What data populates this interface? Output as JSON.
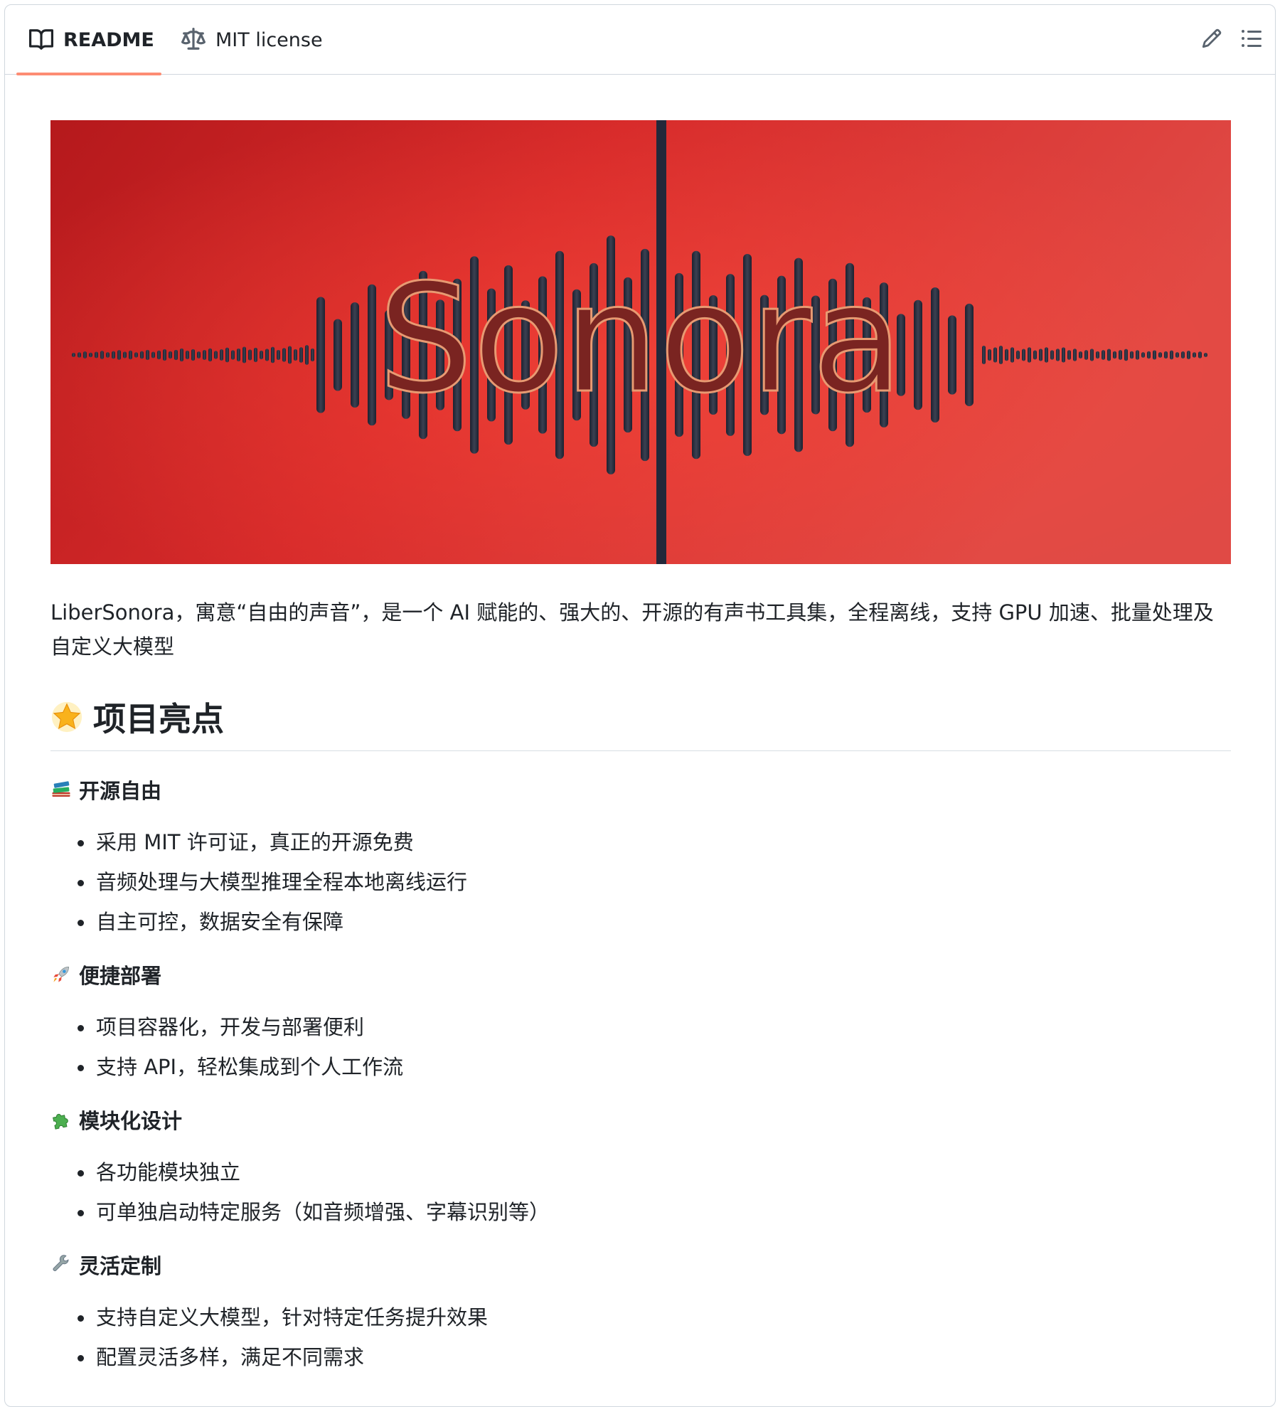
{
  "tabs": {
    "readme_label": "README",
    "license_label": "MIT license"
  },
  "banner": {
    "title": "Sonora",
    "colors": {
      "background": "#d42b2b",
      "bars": "#2a2f3d",
      "letters": "#6e2222"
    }
  },
  "intro": "LiberSonora，寓意“自由的声音”，是一个 AI 赋能的、强大的、开源的有声书工具集，全程离线，支持 GPU 加速、批量处理及自定义大模型",
  "highlights": {
    "heading": "项目亮点",
    "heading_icon": "glowing-star-icon",
    "features": [
      {
        "title": "开源自由",
        "icon": "books-icon",
        "items": [
          "采用 MIT 许可证，真正的开源免费",
          "音频处理与大模型推理全程本地离线运行",
          "自主可控，数据安全有保障"
        ]
      },
      {
        "title": "便捷部署",
        "icon": "rocket-icon",
        "items": [
          "项目容器化，开发与部署便利",
          "支持 API，轻松集成到个人工作流"
        ]
      },
      {
        "title": "模块化设计",
        "icon": "puzzle-piece-icon",
        "items": [
          "各功能模块独立",
          "可单独启动特定服务（如音频增强、字幕识别等）"
        ]
      },
      {
        "title": "灵活定制",
        "icon": "wrench-icon",
        "items": [
          "支持自定义大模型，针对特定任务提升效果",
          "配置灵活多样，满足不同需求"
        ]
      }
    ]
  },
  "accent_color": "#fd8c73"
}
